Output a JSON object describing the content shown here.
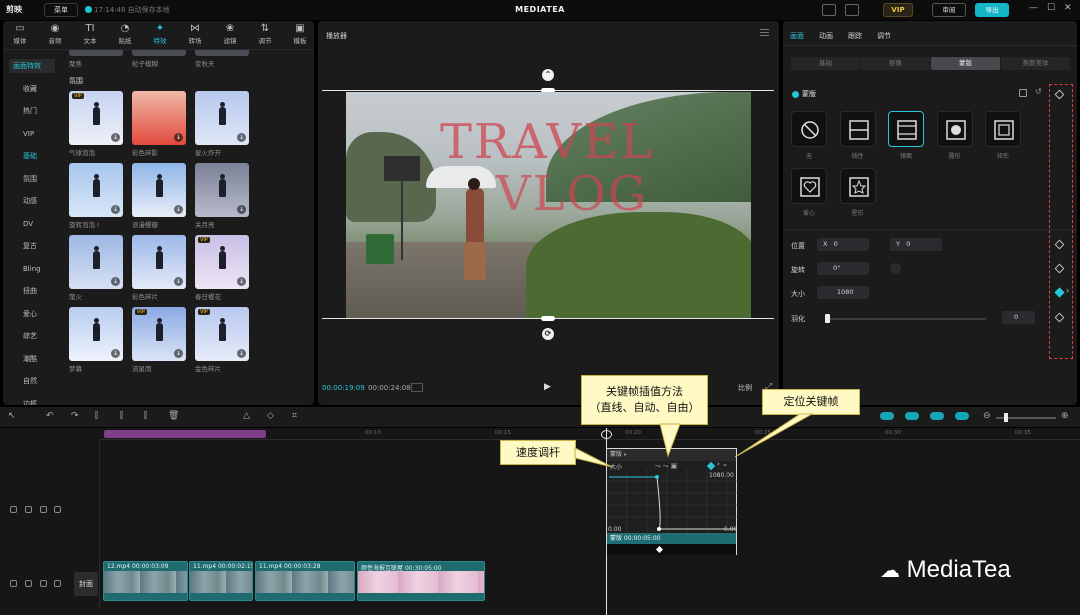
{
  "topbar": {
    "logo": "剪映",
    "menu": "菜单",
    "save_status": "17:14:48 自动保存本地",
    "title": "MEDIATEA",
    "vip": "VIP",
    "review": "审阅",
    "export": "导出"
  },
  "left": {
    "tools": [
      {
        "icon": "▭",
        "label": "媒体"
      },
      {
        "icon": "◉",
        "label": "音频"
      },
      {
        "icon": "TI",
        "label": "文本"
      },
      {
        "icon": "◔",
        "label": "贴纸"
      },
      {
        "icon": "✦",
        "label": "特效"
      },
      {
        "icon": "⋈",
        "label": "转场"
      },
      {
        "icon": "❀",
        "label": "滤镜"
      },
      {
        "icon": "⇅",
        "label": "调节"
      },
      {
        "icon": "▣",
        "label": "模板"
      }
    ],
    "categories": [
      "画面特效",
      "收藏",
      "热门",
      "VIP",
      "基础",
      "氛围",
      "动感",
      "DV",
      "复古",
      "Bling",
      "扭曲",
      "爱心",
      "综艺",
      "潮酷",
      "自然",
      "边框"
    ],
    "top_labels": [
      "聚焦",
      "粒子模糊",
      "变秋天"
    ],
    "section": "氛围",
    "effects": [
      {
        "label": "气球泡泡",
        "vip": "VIP"
      },
      {
        "label": "彩色碎影",
        "vip": ""
      },
      {
        "label": "星火炸开",
        "vip": ""
      },
      {
        "label": "旋转泡泡 I",
        "vip": ""
      },
      {
        "label": "浪漫樱瓣",
        "vip": ""
      },
      {
        "label": "关月亮",
        "vip": ""
      },
      {
        "label": "萤火",
        "vip": ""
      },
      {
        "label": "彩色碎片",
        "vip": ""
      },
      {
        "label": "春日樱花",
        "vip": "VIP"
      },
      {
        "label": "梦幕",
        "vip": ""
      },
      {
        "label": "流星雨",
        "vip": "VIP"
      },
      {
        "label": "金色碎片",
        "vip": "VIP"
      }
    ]
  },
  "player": {
    "title": "播放器",
    "overlay1": "TRAVEL",
    "overlay2": "VLOG",
    "current_time": "00:00:19:09",
    "total_time": "00:00:24:08",
    "ratio_btn": "比例"
  },
  "right": {
    "tabs": [
      "画面",
      "动画",
      "跟踪",
      "调节"
    ],
    "segments": [
      "基础",
      "抠像",
      "蒙版",
      "美颜美体"
    ],
    "mask_toggle": "蒙版",
    "masks": [
      "无",
      "线性",
      "镜面",
      "圆形",
      "矩形",
      "爱心",
      "星形"
    ],
    "props": {
      "position": "位置",
      "x_label": "X",
      "x_value": "0",
      "y_label": "Y",
      "y_value": "0",
      "rotate": "旋转",
      "rotate_value": "0°",
      "size": "大小",
      "size_value": "1080",
      "feather": "羽化",
      "feather_value": "0"
    }
  },
  "timeline": {
    "ticks": [
      "00:00",
      "00:05",
      "00:10",
      "00:15",
      "00:20",
      "00:25",
      "00:30",
      "00:35"
    ],
    "cover": "封面",
    "clips": [
      {
        "name": "12.mp4",
        "dur": "00:00:03:09"
      },
      {
        "name": "11.mp4",
        "dur": "00:00:02:15"
      },
      {
        "name": "11.mp4",
        "dur": "00:00:03:28"
      },
      {
        "name": "颜性海报互联屋",
        "dur": "00:30:05:00"
      }
    ],
    "popup": {
      "header": "蒙版",
      "row": "大小",
      "value_top": "1080.00",
      "value_left": "0.00",
      "value_right": "0.00",
      "footer": "蒙版 00:00:05:00"
    }
  },
  "callouts": {
    "interp": "关键帧插值方法\n（直线、自动、自由）",
    "locate": "定位关键帧",
    "speed": "速度调杆"
  },
  "watermark": "MediaTea",
  "colors": {
    "accent": "#27c6d8",
    "annotation": "#e43b3b",
    "callout_bg": "#fff9c4"
  }
}
